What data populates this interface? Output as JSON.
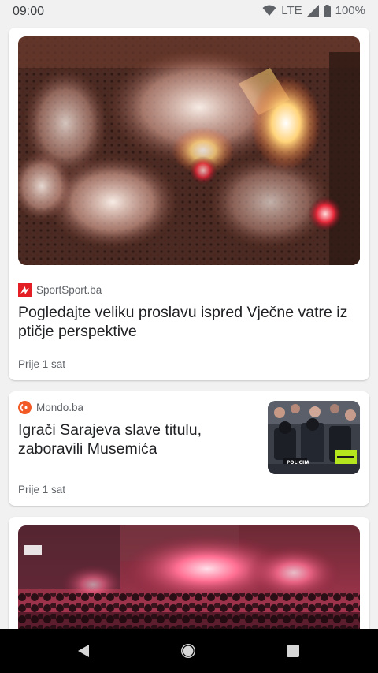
{
  "status_bar": {
    "time": "09:00",
    "network": "LTE",
    "battery": "100%",
    "icons": [
      "wifi-icon",
      "signal-icon",
      "battery-icon"
    ]
  },
  "feed": [
    {
      "source": "SportSport.ba",
      "source_logo": "sportsport-logo",
      "headline": "Pogledajte veliku proslavu ispred Vječne vatre iz ptičje perspektive",
      "time": "Prije 1 sat",
      "image": "aerial crowd with flares"
    },
    {
      "source": "Mondo.ba",
      "source_logo": "mondo-logo",
      "headline": "Igrači Sarajeva slave titulu, zaboravili Musemića",
      "time": "Prije 1 sat",
      "thumbnail_text": "POLICIJA"
    },
    {
      "image": "night crowd with red flares"
    }
  ],
  "nav_bar": {
    "icons": [
      "back-icon",
      "home-icon",
      "recents-icon"
    ]
  },
  "colors": {
    "background": "#f1f1f1",
    "card": "#ffffff",
    "headline_text": "#202124",
    "meta_text": "#5f6368",
    "nav_bar": "#000000",
    "sportsport_red": "#e31e24",
    "mondo_orange": "#f15a24"
  }
}
